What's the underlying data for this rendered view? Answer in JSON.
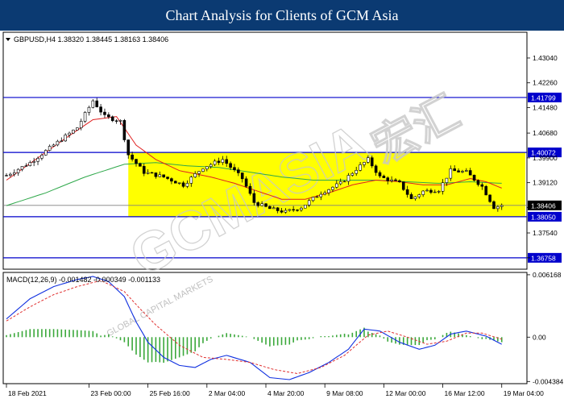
{
  "banner": {
    "title": "Chart Analysis for Clients of GCM Asia"
  },
  "watermark": {
    "brand": "GCMASIA",
    "cjk": "宏汇",
    "tagline": "GLOBAL CAPITAL MARKETS"
  },
  "colors": {
    "highlight": "#ffff00",
    "level_line": "#0000cc",
    "ma_fast": "#e02020",
    "ma_slow": "#2ea84a",
    "macd_line": "#1030e0",
    "signal_line": "#e03030",
    "hist": "#3aa83a",
    "candle": "#000000"
  },
  "chart_data": [
    {
      "type": "candlestick",
      "header": "GBPUSD,H4  1.38320 1.38445 1.38163 1.38406",
      "ylim": [
        1.364,
        1.4385
      ],
      "y_ticks": [
        1.4304,
        1.4226,
        1.4148,
        1.4068,
        1.399,
        1.3912,
        1.3834,
        1.3754,
        1.36758
      ],
      "y_tick_labels": [
        "1.43040",
        "1.42260",
        "1.41480",
        "1.40680",
        "1.39900",
        "1.39120",
        "",
        "1.37540",
        ""
      ],
      "levels": [
        {
          "value": 1.41799,
          "label": "1.41799"
        },
        {
          "value": 1.40072,
          "label": "1.40072"
        },
        {
          "value": 1.3805,
          "label": "1.38050"
        },
        {
          "value": 1.36758,
          "label": "1.36758"
        }
      ],
      "current_price": {
        "value": 1.38406,
        "label": "1.38406"
      },
      "range_box": {
        "from_index": 31,
        "to_index": 132,
        "top": 1.40072,
        "bottom": 1.3805
      },
      "x_ticks": [
        {
          "index": 0,
          "label": "18 Feb 2021"
        },
        {
          "index": 21,
          "label": "23 Feb 00:00"
        },
        {
          "index": 36,
          "label": "25 Feb 16:00"
        },
        {
          "index": 51,
          "label": "2 Mar 04:00"
        },
        {
          "index": 66,
          "label": "4 Mar 20:00"
        },
        {
          "index": 81,
          "label": "9 Mar 08:00"
        },
        {
          "index": 96,
          "label": "12 Mar 00:00"
        },
        {
          "index": 111,
          "label": "16 Mar 12:00"
        },
        {
          "index": 126,
          "label": "19 Mar 04:00"
        }
      ],
      "close_anchors": [
        [
          0,
          1.3935
        ],
        [
          6,
          1.3975
        ],
        [
          12,
          1.403
        ],
        [
          18,
          1.4085
        ],
        [
          22,
          1.417
        ],
        [
          25,
          1.412
        ],
        [
          29,
          1.4105
        ],
        [
          31,
          1.4
        ],
        [
          35,
          1.3945
        ],
        [
          40,
          1.393
        ],
        [
          45,
          1.3905
        ],
        [
          50,
          1.396
        ],
        [
          55,
          1.3985
        ],
        [
          60,
          1.3925
        ],
        [
          63,
          1.385
        ],
        [
          67,
          1.383
        ],
        [
          71,
          1.382
        ],
        [
          75,
          1.3835
        ],
        [
          80,
          1.388
        ],
        [
          85,
          1.391
        ],
        [
          89,
          1.3955
        ],
        [
          92,
          1.3985
        ],
        [
          95,
          1.393
        ],
        [
          100,
          1.391
        ],
        [
          103,
          1.386
        ],
        [
          106,
          1.3885
        ],
        [
          110,
          1.389
        ],
        [
          113,
          1.395
        ],
        [
          117,
          1.3945
        ],
        [
          121,
          1.39
        ],
        [
          124,
          1.3835
        ],
        [
          126,
          1.3841
        ]
      ],
      "ma_fast_anchors": [
        [
          0,
          1.392
        ],
        [
          8,
          1.399
        ],
        [
          16,
          1.406
        ],
        [
          22,
          1.411
        ],
        [
          28,
          1.412
        ],
        [
          33,
          1.403
        ],
        [
          38,
          1.3985
        ],
        [
          44,
          1.395
        ],
        [
          52,
          1.393
        ],
        [
          58,
          1.391
        ],
        [
          64,
          1.3885
        ],
        [
          70,
          1.386
        ],
        [
          76,
          1.386
        ],
        [
          82,
          1.388
        ],
        [
          88,
          1.3905
        ],
        [
          94,
          1.392
        ],
        [
          100,
          1.3915
        ],
        [
          106,
          1.3905
        ],
        [
          112,
          1.3905
        ],
        [
          118,
          1.3925
        ],
        [
          122,
          1.3915
        ],
        [
          126,
          1.3895
        ]
      ],
      "ma_slow_anchors": [
        [
          0,
          1.384
        ],
        [
          10,
          1.388
        ],
        [
          20,
          1.393
        ],
        [
          30,
          1.397
        ],
        [
          38,
          1.3975
        ],
        [
          46,
          1.3965
        ],
        [
          54,
          1.396
        ],
        [
          62,
          1.3945
        ],
        [
          70,
          1.393
        ],
        [
          78,
          1.392
        ],
        [
          86,
          1.392
        ],
        [
          94,
          1.392
        ],
        [
          102,
          1.3915
        ],
        [
          110,
          1.391
        ],
        [
          118,
          1.3915
        ],
        [
          126,
          1.391
        ]
      ]
    },
    {
      "type": "macd",
      "label": "MACD(12,26,9) -0.001482 -0.000349 -0.001133",
      "ylim": [
        -0.0046,
        0.0064
      ],
      "y_ticks": [
        0.006168,
        0.0,
        -0.004384
      ],
      "y_tick_labels": [
        "0.006168",
        "0.00",
        "-0.004384"
      ],
      "macd_anchors": [
        [
          0,
          0.0018
        ],
        [
          6,
          0.0038
        ],
        [
          12,
          0.005
        ],
        [
          18,
          0.0057
        ],
        [
          22,
          0.006
        ],
        [
          26,
          0.0055
        ],
        [
          30,
          0.004
        ],
        [
          33,
          0.0015
        ],
        [
          36,
          -0.0005
        ],
        [
          40,
          -0.002
        ],
        [
          44,
          -0.0028
        ],
        [
          48,
          -0.003
        ],
        [
          52,
          -0.0022
        ],
        [
          56,
          -0.0018
        ],
        [
          62,
          -0.0025
        ],
        [
          67,
          -0.004
        ],
        [
          72,
          -0.0042
        ],
        [
          77,
          -0.0035
        ],
        [
          82,
          -0.0025
        ],
        [
          87,
          -0.0012
        ],
        [
          91,
          0.0008
        ],
        [
          95,
          0.0006
        ],
        [
          100,
          -0.0005
        ],
        [
          105,
          -0.0012
        ],
        [
          109,
          -0.0008
        ],
        [
          113,
          0.0003
        ],
        [
          117,
          0.0006
        ],
        [
          122,
          0.0001
        ],
        [
          126,
          -0.0007
        ]
      ],
      "signal_anchors": [
        [
          0,
          0.0016
        ],
        [
          6,
          0.003
        ],
        [
          12,
          0.0042
        ],
        [
          18,
          0.005
        ],
        [
          24,
          0.0056
        ],
        [
          30,
          0.0045
        ],
        [
          34,
          0.0028
        ],
        [
          38,
          0.0012
        ],
        [
          44,
          -0.0008
        ],
        [
          50,
          -0.002
        ],
        [
          56,
          -0.0022
        ],
        [
          62,
          -0.0025
        ],
        [
          68,
          -0.0032
        ],
        [
          74,
          -0.0036
        ],
        [
          80,
          -0.003
        ],
        [
          86,
          -0.0018
        ],
        [
          92,
          0.0002
        ],
        [
          97,
          0.0006
        ],
        [
          102,
          0.0
        ],
        [
          107,
          -0.0007
        ],
        [
          112,
          -0.0004
        ],
        [
          117,
          0.0004
        ],
        [
          121,
          0.0004
        ],
        [
          126,
          -0.0002
        ]
      ]
    }
  ]
}
